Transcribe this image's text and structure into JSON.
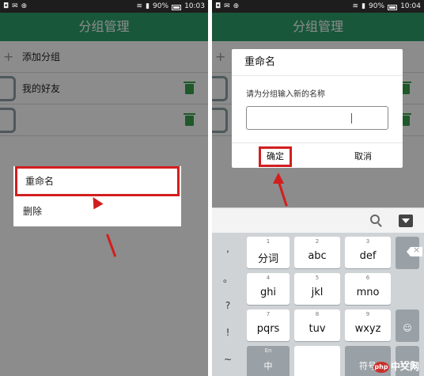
{
  "status": {
    "icons_left": [
      "◘",
      "✉",
      "⊕"
    ],
    "battery": "90%",
    "time_left": "10:03",
    "time_right": "10:04"
  },
  "app": {
    "title": "分组管理"
  },
  "groups": {
    "add_label": "添加分组",
    "items": [
      {
        "label": "我的好友"
      },
      {
        "label": ""
      }
    ]
  },
  "context_menu": {
    "rename": "重命名",
    "delete": "删除"
  },
  "dialog": {
    "title": "重命名",
    "prompt": "请为分组输入新的名称",
    "input_value": "",
    "ok": "确定",
    "cancel": "取消"
  },
  "keyboard": {
    "side": [
      ",",
      "。",
      "?",
      "!",
      "~"
    ],
    "keys": [
      {
        "num": "1",
        "label": "分词"
      },
      {
        "num": "2",
        "label": "abc"
      },
      {
        "num": "3",
        "label": "def"
      },
      {
        "num": "4",
        "label": "ghi"
      },
      {
        "num": "5",
        "label": "jkl"
      },
      {
        "num": "6",
        "label": "mno"
      },
      {
        "num": "7",
        "label": "pqrs"
      },
      {
        "num": "8",
        "label": "tuv"
      },
      {
        "num": "9",
        "label": "wxyz"
      },
      {
        "num": "En",
        "label": "中"
      },
      {
        "num": "",
        "label": ""
      },
      {
        "num": "",
        "label": "符号"
      },
      {
        "num": "",
        "label": "123"
      }
    ]
  },
  "watermark": {
    "badge": "php",
    "text": "中文网"
  }
}
